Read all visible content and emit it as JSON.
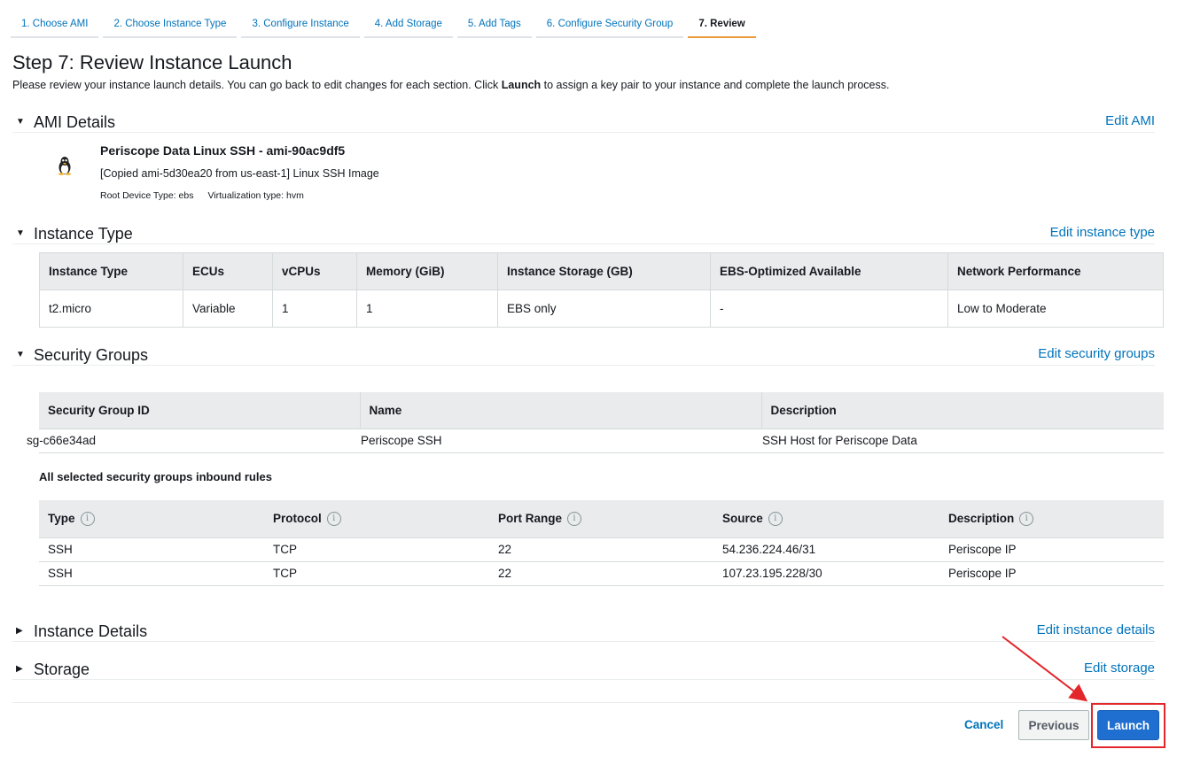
{
  "wizard": {
    "steps": [
      {
        "label": "1. Choose AMI"
      },
      {
        "label": "2. Choose Instance Type"
      },
      {
        "label": "3. Configure Instance"
      },
      {
        "label": "4. Add Storage"
      },
      {
        "label": "5. Add Tags"
      },
      {
        "label": "6. Configure Security Group"
      },
      {
        "label": "7. Review"
      }
    ],
    "active_step": "7. Review"
  },
  "header": {
    "title": "Step 7: Review Instance Launch",
    "desc_before": "Please review your instance launch details. You can go back to edit changes for each section. Click ",
    "desc_bold": "Launch",
    "desc_after": " to assign a key pair to your instance and complete the launch process."
  },
  "sections": {
    "ami": {
      "title": "AMI Details",
      "edit_label": "Edit AMI",
      "icon": "linux-penguin-icon",
      "name": "Periscope Data Linux SSH - ami-90ac9df5",
      "description": "[Copied ami-5d30ea20 from us-east-1] Linux SSH Image",
      "root_device": "Root Device Type: ebs",
      "virtualization": "Virtualization type: hvm"
    },
    "instance_type": {
      "title": "Instance Type",
      "edit_label": "Edit instance type",
      "columns": [
        "Instance Type",
        "ECUs",
        "vCPUs",
        "Memory (GiB)",
        "Instance Storage (GB)",
        "EBS-Optimized Available",
        "Network Performance"
      ],
      "row": [
        "t2.micro",
        "Variable",
        "1",
        "1",
        "EBS only",
        "-",
        "Low to Moderate"
      ]
    },
    "security_groups": {
      "title": "Security Groups",
      "edit_label": "Edit security groups",
      "columns": [
        "Security Group ID",
        "Name",
        "Description"
      ],
      "row": [
        "sg-c66e34ad",
        "Periscope SSH",
        "SSH Host for Periscope Data"
      ],
      "inbound_label": "All selected security groups inbound rules",
      "rule_columns": [
        "Type",
        "Protocol",
        "Port Range",
        "Source",
        "Description"
      ],
      "rules": [
        [
          "SSH",
          "TCP",
          "22",
          "54.236.224.46/31",
          "Periscope IP"
        ],
        [
          "SSH",
          "TCP",
          "22",
          "107.23.195.228/30",
          "Periscope IP"
        ]
      ]
    },
    "instance_details": {
      "title": "Instance Details",
      "edit_label": "Edit instance details"
    },
    "storage": {
      "title": "Storage",
      "edit_label": "Edit storage"
    }
  },
  "footer": {
    "cancel_label": "Cancel",
    "previous_label": "Previous",
    "launch_label": "Launch"
  },
  "colors": {
    "link": "#0073bb",
    "launch_button": "#1f6fd1",
    "active_tab_underline": "#ec9a3c",
    "annotation": "#e3262a"
  }
}
